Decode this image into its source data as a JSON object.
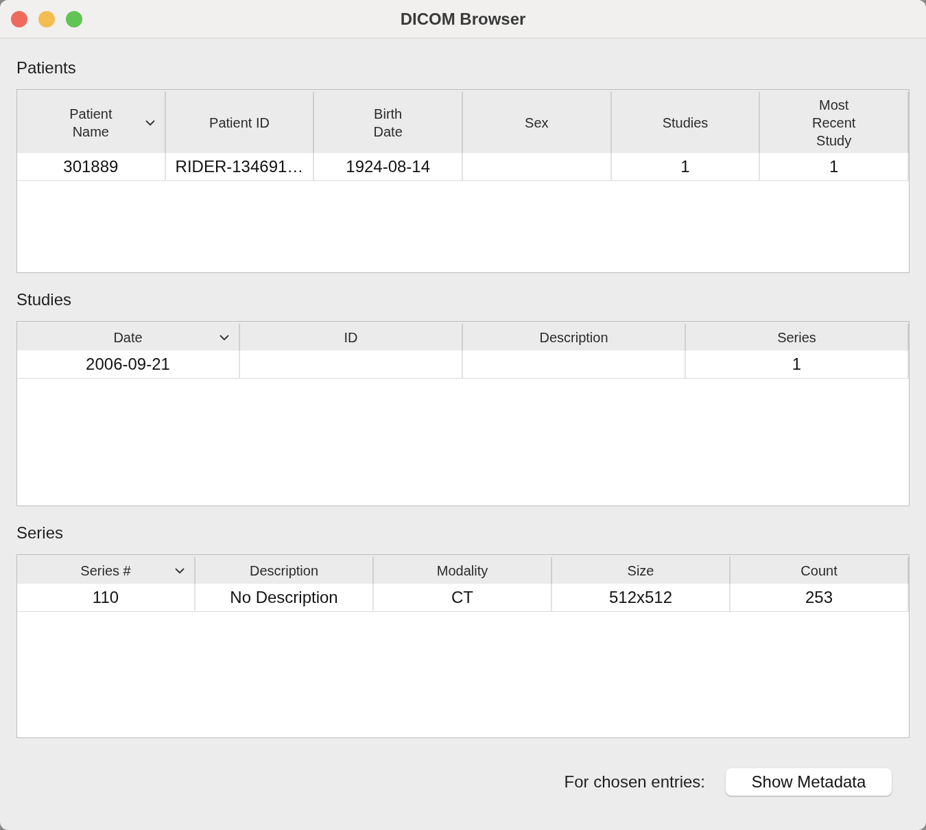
{
  "window": {
    "title": "DICOM Browser"
  },
  "sections": [
    {
      "label": "Patients",
      "columns": [
        {
          "label": "Patient\nName",
          "sorted": true
        },
        {
          "label": "Patient ID",
          "sorted": false
        },
        {
          "label": "Birth\nDate",
          "sorted": false
        },
        {
          "label": "Sex",
          "sorted": false
        },
        {
          "label": "Studies",
          "sorted": false
        },
        {
          "label": "Most\nRecent\nStudy",
          "sorted": false
        }
      ],
      "rows": [
        [
          "301889",
          "RIDER-134691…",
          "1924-08-14",
          "",
          "1",
          "1"
        ]
      ]
    },
    {
      "label": "Studies",
      "columns": [
        {
          "label": "Date",
          "sorted": true
        },
        {
          "label": "ID",
          "sorted": false
        },
        {
          "label": "Description",
          "sorted": false
        },
        {
          "label": "Series",
          "sorted": false
        }
      ],
      "rows": [
        [
          "2006-09-21",
          "",
          "",
          "1"
        ]
      ]
    },
    {
      "label": "Series",
      "columns": [
        {
          "label": "Series #",
          "sorted": true
        },
        {
          "label": "Description",
          "sorted": false
        },
        {
          "label": "Modality",
          "sorted": false
        },
        {
          "label": "Size",
          "sorted": false
        },
        {
          "label": "Count",
          "sorted": false
        }
      ],
      "rows": [
        [
          "110",
          "No Description",
          "CT",
          "512x512",
          "253"
        ]
      ]
    }
  ],
  "footer": {
    "label": "For chosen entries:",
    "button": "Show Metadata"
  }
}
